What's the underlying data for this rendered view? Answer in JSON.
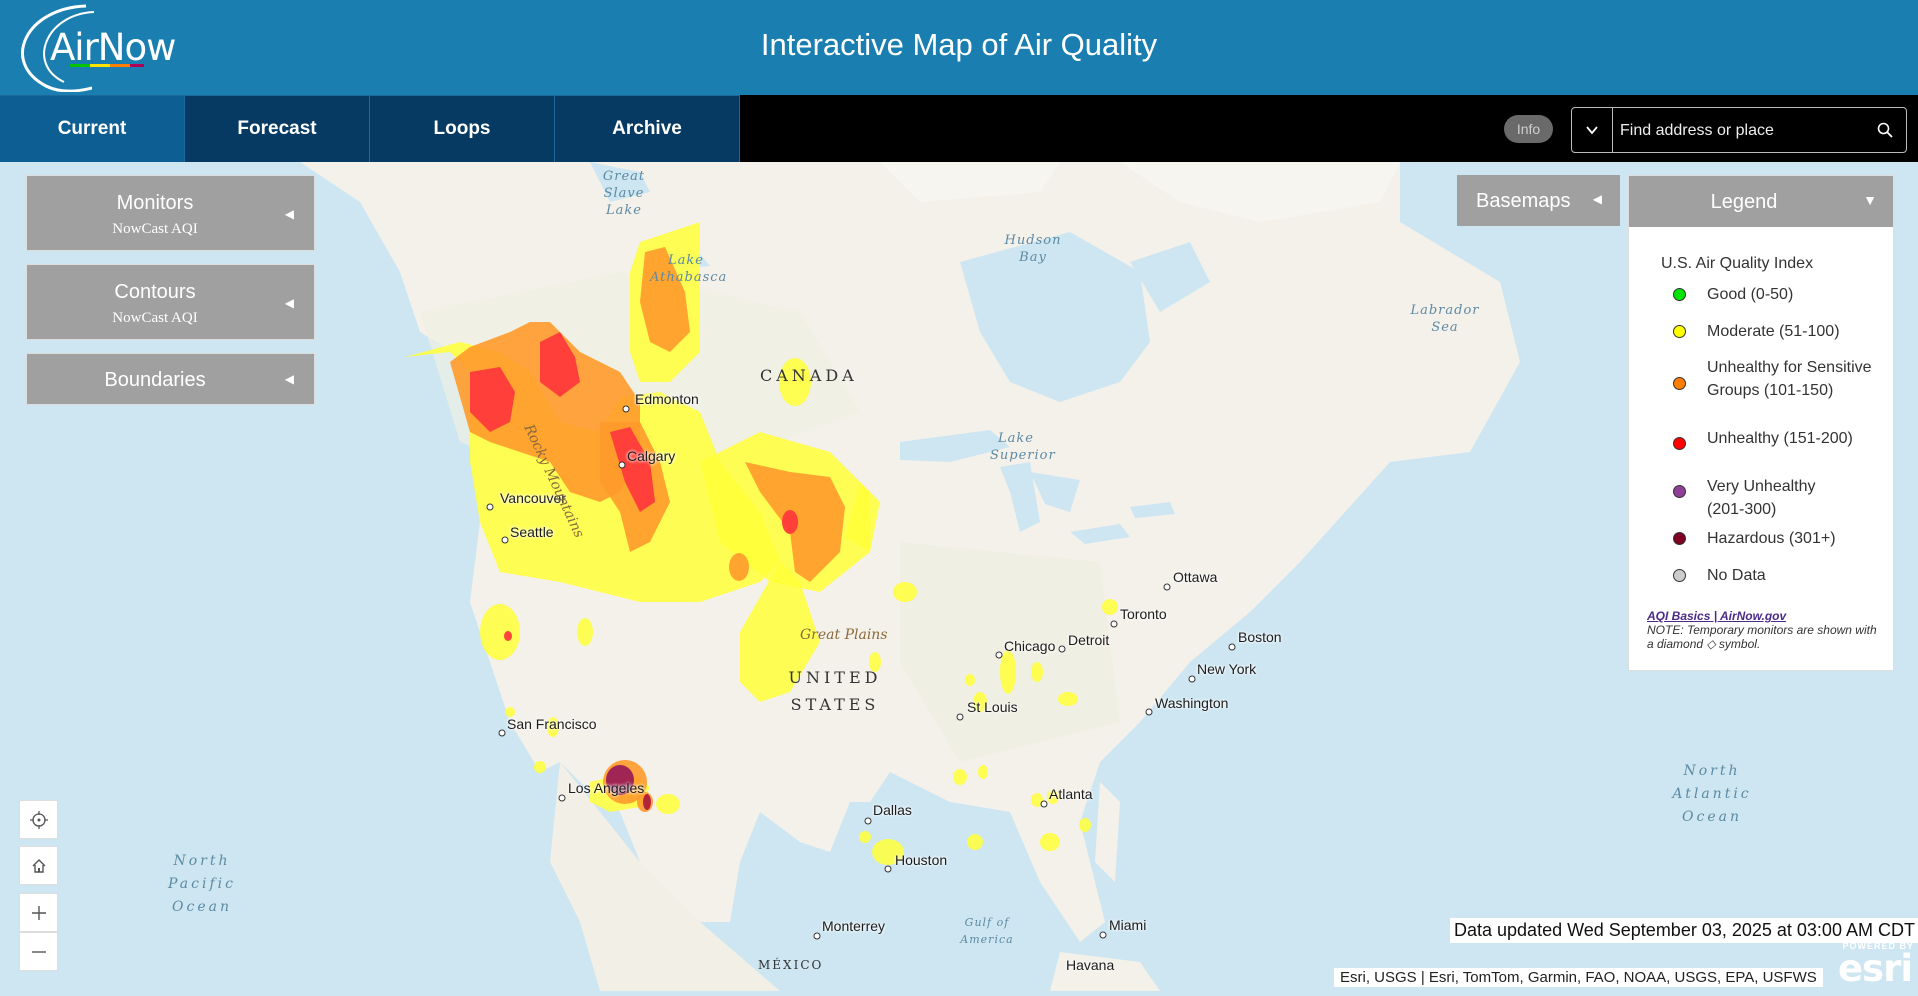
{
  "header": {
    "logo_text": "AirNow",
    "title": "Interactive Map of Air Quality"
  },
  "nav": {
    "tabs": [
      {
        "label": "Current"
      },
      {
        "label": "Forecast"
      },
      {
        "label": "Loops"
      },
      {
        "label": "Archive"
      }
    ]
  },
  "toolbar": {
    "info_label": "Info",
    "search_placeholder": "Find address or place"
  },
  "layers_panel": [
    {
      "title": "Monitors",
      "subtitle": "NowCast AQI"
    },
    {
      "title": "Contours",
      "subtitle": "NowCast AQI"
    },
    {
      "title": "Boundaries",
      "subtitle": ""
    }
  ],
  "basemaps": {
    "label": "Basemaps"
  },
  "legend": {
    "header": "Legend",
    "title": "U.S. Air Quality Index",
    "items": [
      {
        "label": "Good (0-50)",
        "color": "#00e400"
      },
      {
        "label": "Moderate (51-100)",
        "color": "#ffff00"
      },
      {
        "label": "Unhealthy for Sensitive Groups (101-150)",
        "color": "#ff7e00"
      },
      {
        "label": "Unhealthy (151-200)",
        "color": "#ff0000"
      },
      {
        "label": "Very Unhealthy (201-300)",
        "color": "#8f3f97"
      },
      {
        "label": "Hazardous (301+)",
        "color": "#7e0023"
      },
      {
        "label": "No Data",
        "color": "#cccccc"
      }
    ],
    "link_text": "AQI Basics | AirNow.gov",
    "note": "NOTE: Temporary monitors are shown with a diamond ◇ symbol."
  },
  "map": {
    "cities": [
      "Edmonton",
      "Calgary",
      "Vancouver",
      "Seattle",
      "San Francisco",
      "Los Angeles",
      "Dallas",
      "Houston",
      "Chicago",
      "Detroit",
      "St Louis",
      "Atlanta",
      "Toronto",
      "Ottawa",
      "Boston",
      "New York",
      "Washington",
      "Miami",
      "Havana",
      "Monterrey"
    ],
    "water_labels": [
      "Great Slave Lake",
      "Lake Athabasca",
      "Hudson Bay",
      "Labrador Sea",
      "Lake Superior",
      "North Pacific Ocean",
      "North Atlantic Ocean",
      "Gulf of America"
    ],
    "country_labels": [
      "CANADA",
      "UNITED STATES",
      "MÉXICO"
    ],
    "feature_labels": [
      "Rocky Mountains",
      "Great Plains"
    ]
  },
  "status": {
    "data_updated": "Data updated Wed September 03, 2025 at 03:00 AM CDT",
    "attribution": "Esri, USGS | Esri, TomTom, Garmin, FAO, NOAA, USGS, EPA, USFWS",
    "esri_powered": "POWERED BY",
    "esri_logo": "esri"
  },
  "colors": {
    "header_bg": "#1a7fb0",
    "tab_bg": "#063a62",
    "tab_active_bg": "#0c5e93",
    "panel_gray": "#a0a0a0"
  }
}
